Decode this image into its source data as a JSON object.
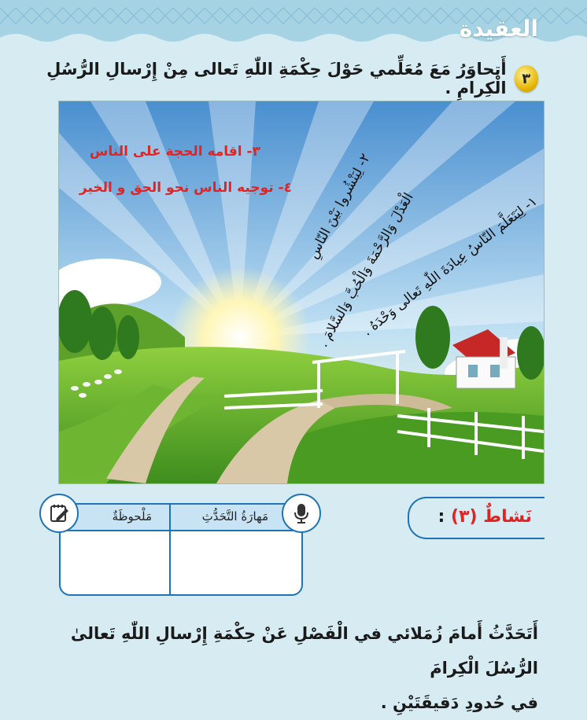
{
  "header": {
    "title": "العقيدة"
  },
  "question": {
    "number": "٣",
    "text": "أَتحاوَرُ مَعَ مُعَلِّمي حَوْلَ حِكْمَةِ اللّٰهِ تَعالى مِنْ إِرْسالِ الرُّسُلِ الْكِرامِ ."
  },
  "scene": {
    "red_line_1": "٣- اقامه الحجة على الناس",
    "red_line_2": "٤- توجيه الناس نحو الحق و الخير",
    "ray_1": "١- لِيَتَعَلَّمَ النّاسُ عِبادَةَ اللّٰهِ تَعالى وَحْدَهُ .",
    "ray_2a": "٢- لِيَنْشُروا بَيْنَ النّاسِ",
    "ray_2b": "الْعَدْلَ وَالرَّحْمَةَ وَالْحُبَّ وَالسَّلامَ ."
  },
  "note_table": {
    "skill_label": "مَهارَةُ التَّحَدُّثِ",
    "note_label": "مَلْحوظَةٌ",
    "mic_icon": "microphone-icon",
    "pencil_icon": "pencil-note-icon"
  },
  "activity": {
    "label": "نَشاطٌ (٣)",
    "colon": ":"
  },
  "bottom": {
    "line_1": "أَتَحَدَّثُ أَمامَ زُمَلائي في الْفَصْلِ عَنْ حِكْمَةِ إِرْسالِ اللّٰهِ تَعالىٰ الرُّسُلَ الْكِرامَ",
    "line_2": "في حُدودِ دَقيقَتَيْنِ ."
  },
  "colors": {
    "accent_blue": "#1f73b8",
    "red_text": "#e02424",
    "badge_gold": "#e4b400"
  }
}
